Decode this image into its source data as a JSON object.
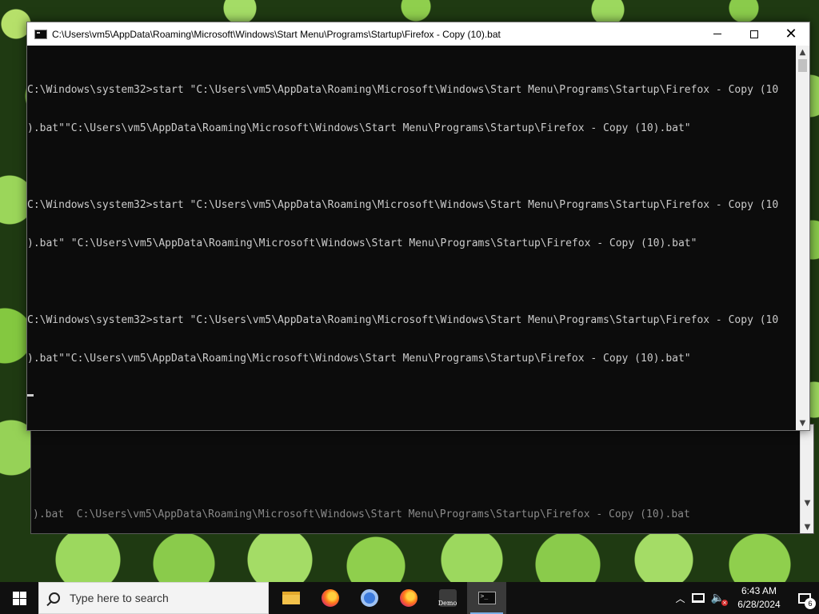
{
  "background_window": {
    "visible_line": ").bat  C:\\Users\\vm5\\AppData\\Roaming\\Microsoft\\Windows\\Start Menu\\Programs\\Startup\\Firefox - Copy (10).bat"
  },
  "window": {
    "title": "C:\\Users\\vm5\\AppData\\Roaming\\Microsoft\\Windows\\Start Menu\\Programs\\Startup\\Firefox - Copy (10).bat",
    "minimize_label": "minimize",
    "maximize_label": "maximize",
    "close_label": "close"
  },
  "console": {
    "lines": [
      {
        "l1": "C:\\Windows\\system32>start \"C:\\Users\\vm5\\AppData\\Roaming\\Microsoft\\Windows\\Start Menu\\Programs\\Startup\\Firefox - Copy (10",
        "l2": ").bat\"\"C:\\Users\\vm5\\AppData\\Roaming\\Microsoft\\Windows\\Start Menu\\Programs\\Startup\\Firefox - Copy (10).bat\""
      },
      {
        "l1": "C:\\Windows\\system32>start \"C:\\Users\\vm5\\AppData\\Roaming\\Microsoft\\Windows\\Start Menu\\Programs\\Startup\\Firefox - Copy (10",
        "l2": ").bat\" \"C:\\Users\\vm5\\AppData\\Roaming\\Microsoft\\Windows\\Start Menu\\Programs\\Startup\\Firefox - Copy (10).bat\""
      },
      {
        "l1": "C:\\Windows\\system32>start \"C:\\Users\\vm5\\AppData\\Roaming\\Microsoft\\Windows\\Start Menu\\Programs\\Startup\\Firefox - Copy (10",
        "l2": ").bat\"\"C:\\Users\\vm5\\AppData\\Roaming\\Microsoft\\Windows\\Start Menu\\Programs\\Startup\\Firefox - Copy (10).bat\""
      }
    ]
  },
  "taskbar": {
    "search_placeholder": "Type here to search",
    "apps": [
      {
        "icon": "folder-icon",
        "active": false
      },
      {
        "icon": "firefox-icon",
        "active": false
      },
      {
        "icon": "chrome-icon",
        "active": false
      },
      {
        "icon": "firefox-icon",
        "active": false
      },
      {
        "icon": "demo-icon",
        "label": "Demo",
        "active": false
      },
      {
        "icon": "cmd-icon",
        "active": true
      }
    ],
    "clock_time": "6:43 AM",
    "clock_date": "6/28/2024",
    "notification_count": "6"
  }
}
